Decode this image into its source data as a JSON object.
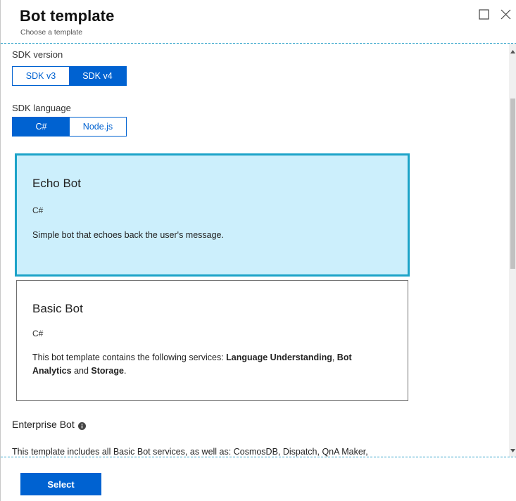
{
  "header": {
    "title": "Bot template",
    "subtitle": "Choose a template"
  },
  "sdk_version": {
    "label": "SDK version",
    "options": [
      "SDK v3",
      "SDK v4"
    ],
    "selected": "SDK v4"
  },
  "sdk_language": {
    "label": "SDK language",
    "options": [
      "C#",
      "Node.js"
    ],
    "selected": "C#"
  },
  "templates": [
    {
      "title": "Echo Bot",
      "language": "C#",
      "description": "Simple bot that echoes back the user's message.",
      "selected": true
    },
    {
      "title": "Basic Bot",
      "language": "C#",
      "description_prefix": "This bot template contains the following services: ",
      "bold_1": "Language Understanding",
      "sep_1": ", ",
      "bold_2": "Bot Analytics",
      "sep_2": " and ",
      "bold_3": "Storage",
      "suffix": ".",
      "selected": false
    }
  ],
  "enterprise": {
    "title": "Enterprise Bot",
    "info_icon": "info-icon",
    "description": "This template includes all Basic Bot services, as well as: CosmosDB, Dispatch, QnA Maker,"
  },
  "footer": {
    "select_label": "Select"
  },
  "colors": {
    "accent": "#0062d1",
    "selected_card_bg": "#cceffc",
    "selected_card_border": "#1ca3c8"
  }
}
